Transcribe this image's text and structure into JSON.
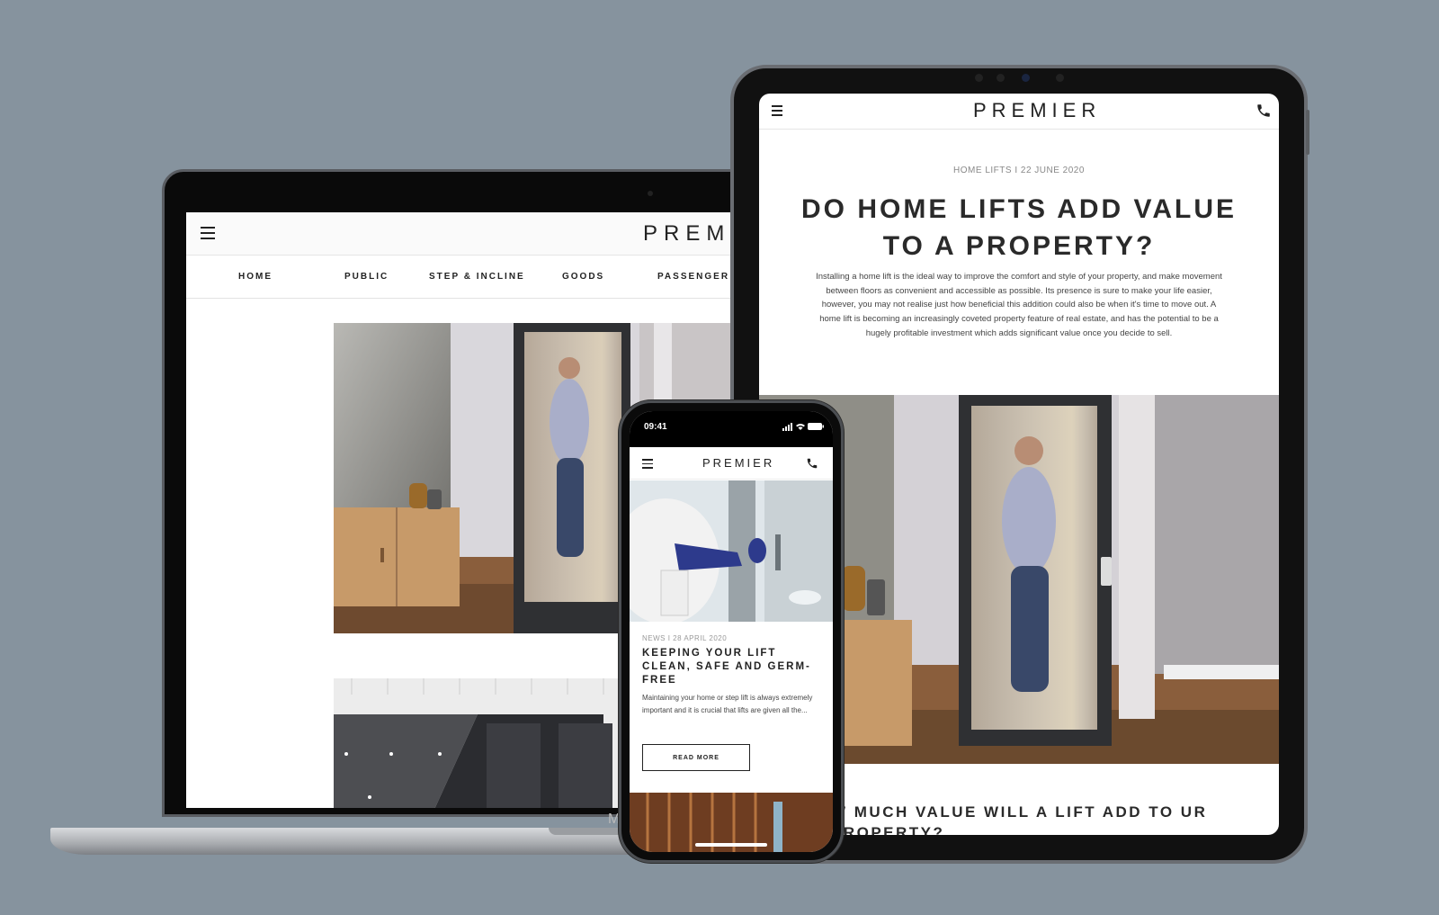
{
  "colors": {
    "background": "#86939e",
    "text_dark": "#222222",
    "text_muted": "#888888"
  },
  "laptop": {
    "logo": "PREMIE",
    "brand": "M",
    "nav": [
      "HOME",
      "PUBLIC",
      "STEP & INCLINE",
      "GOODS",
      "PASSENGER"
    ]
  },
  "tablet": {
    "logo": "PREMIER",
    "meta": "HOME LIFTS I 22 JUNE 2020",
    "title": "DO HOME LIFTS ADD VALUE TO A PROPERTY?",
    "body": "Installing a home lift is the ideal way to improve the comfort and style of your property, and make movement between floors as convenient and accessible as possible. Its presence is sure to make your life easier, however, you may not realise just how beneficial this addition could also be when it's time to move out. A home lift is becoming an increasingly coveted property feature of real estate, and has the potential to be a hugely profitable investment which adds significant value once you decide to sell.",
    "subheading": "W MUCH VALUE WILL A LIFT ADD TO UR PROPERTY?"
  },
  "phone": {
    "time": "09:41",
    "logo": "PREMIER",
    "meta": "NEWS I 28 APRIL 2020",
    "title": "KEEPING YOUR LIFT CLEAN, SAFE AND GERM-FREE",
    "excerpt": "Maintaining your home or step lift is always extremely important and it is crucial that lifts are given all the...",
    "button": "READ MORE"
  },
  "icons": {
    "menu": "hamburger-menu-icon",
    "phone": "phone-icon",
    "signal": "signal-icon",
    "wifi": "wifi-icon",
    "battery": "battery-icon"
  }
}
